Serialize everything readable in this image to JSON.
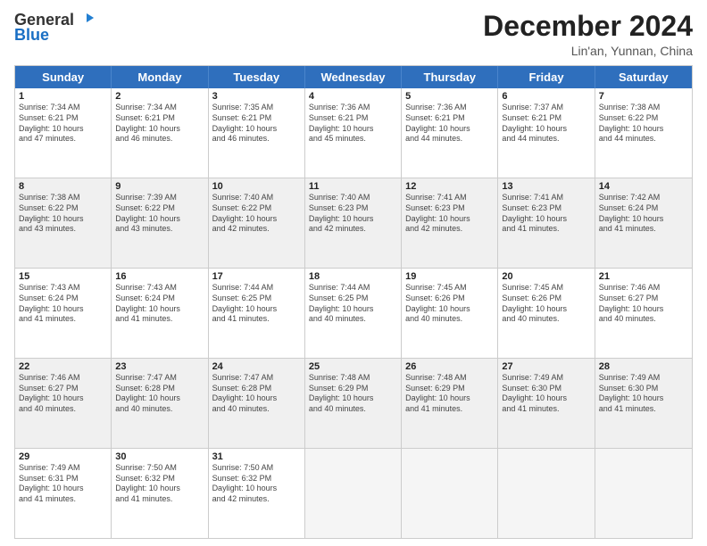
{
  "header": {
    "logo_general": "General",
    "logo_blue": "Blue",
    "title": "December 2024",
    "location": "Lin'an, Yunnan, China"
  },
  "days_of_week": [
    "Sunday",
    "Monday",
    "Tuesday",
    "Wednesday",
    "Thursday",
    "Friday",
    "Saturday"
  ],
  "weeks": [
    [
      {
        "day": "1",
        "info": "Sunrise: 7:34 AM\nSunset: 6:21 PM\nDaylight: 10 hours\nand 47 minutes."
      },
      {
        "day": "2",
        "info": "Sunrise: 7:34 AM\nSunset: 6:21 PM\nDaylight: 10 hours\nand 46 minutes."
      },
      {
        "day": "3",
        "info": "Sunrise: 7:35 AM\nSunset: 6:21 PM\nDaylight: 10 hours\nand 46 minutes."
      },
      {
        "day": "4",
        "info": "Sunrise: 7:36 AM\nSunset: 6:21 PM\nDaylight: 10 hours\nand 45 minutes."
      },
      {
        "day": "5",
        "info": "Sunrise: 7:36 AM\nSunset: 6:21 PM\nDaylight: 10 hours\nand 44 minutes."
      },
      {
        "day": "6",
        "info": "Sunrise: 7:37 AM\nSunset: 6:21 PM\nDaylight: 10 hours\nand 44 minutes."
      },
      {
        "day": "7",
        "info": "Sunrise: 7:38 AM\nSunset: 6:22 PM\nDaylight: 10 hours\nand 44 minutes."
      }
    ],
    [
      {
        "day": "8",
        "info": "Sunrise: 7:38 AM\nSunset: 6:22 PM\nDaylight: 10 hours\nand 43 minutes."
      },
      {
        "day": "9",
        "info": "Sunrise: 7:39 AM\nSunset: 6:22 PM\nDaylight: 10 hours\nand 43 minutes."
      },
      {
        "day": "10",
        "info": "Sunrise: 7:40 AM\nSunset: 6:22 PM\nDaylight: 10 hours\nand 42 minutes."
      },
      {
        "day": "11",
        "info": "Sunrise: 7:40 AM\nSunset: 6:23 PM\nDaylight: 10 hours\nand 42 minutes."
      },
      {
        "day": "12",
        "info": "Sunrise: 7:41 AM\nSunset: 6:23 PM\nDaylight: 10 hours\nand 42 minutes."
      },
      {
        "day": "13",
        "info": "Sunrise: 7:41 AM\nSunset: 6:23 PM\nDaylight: 10 hours\nand 41 minutes."
      },
      {
        "day": "14",
        "info": "Sunrise: 7:42 AM\nSunset: 6:24 PM\nDaylight: 10 hours\nand 41 minutes."
      }
    ],
    [
      {
        "day": "15",
        "info": "Sunrise: 7:43 AM\nSunset: 6:24 PM\nDaylight: 10 hours\nand 41 minutes."
      },
      {
        "day": "16",
        "info": "Sunrise: 7:43 AM\nSunset: 6:24 PM\nDaylight: 10 hours\nand 41 minutes."
      },
      {
        "day": "17",
        "info": "Sunrise: 7:44 AM\nSunset: 6:25 PM\nDaylight: 10 hours\nand 41 minutes."
      },
      {
        "day": "18",
        "info": "Sunrise: 7:44 AM\nSunset: 6:25 PM\nDaylight: 10 hours\nand 40 minutes."
      },
      {
        "day": "19",
        "info": "Sunrise: 7:45 AM\nSunset: 6:26 PM\nDaylight: 10 hours\nand 40 minutes."
      },
      {
        "day": "20",
        "info": "Sunrise: 7:45 AM\nSunset: 6:26 PM\nDaylight: 10 hours\nand 40 minutes."
      },
      {
        "day": "21",
        "info": "Sunrise: 7:46 AM\nSunset: 6:27 PM\nDaylight: 10 hours\nand 40 minutes."
      }
    ],
    [
      {
        "day": "22",
        "info": "Sunrise: 7:46 AM\nSunset: 6:27 PM\nDaylight: 10 hours\nand 40 minutes."
      },
      {
        "day": "23",
        "info": "Sunrise: 7:47 AM\nSunset: 6:28 PM\nDaylight: 10 hours\nand 40 minutes."
      },
      {
        "day": "24",
        "info": "Sunrise: 7:47 AM\nSunset: 6:28 PM\nDaylight: 10 hours\nand 40 minutes."
      },
      {
        "day": "25",
        "info": "Sunrise: 7:48 AM\nSunset: 6:29 PM\nDaylight: 10 hours\nand 40 minutes."
      },
      {
        "day": "26",
        "info": "Sunrise: 7:48 AM\nSunset: 6:29 PM\nDaylight: 10 hours\nand 41 minutes."
      },
      {
        "day": "27",
        "info": "Sunrise: 7:49 AM\nSunset: 6:30 PM\nDaylight: 10 hours\nand 41 minutes."
      },
      {
        "day": "28",
        "info": "Sunrise: 7:49 AM\nSunset: 6:30 PM\nDaylight: 10 hours\nand 41 minutes."
      }
    ],
    [
      {
        "day": "29",
        "info": "Sunrise: 7:49 AM\nSunset: 6:31 PM\nDaylight: 10 hours\nand 41 minutes."
      },
      {
        "day": "30",
        "info": "Sunrise: 7:50 AM\nSunset: 6:32 PM\nDaylight: 10 hours\nand 41 minutes."
      },
      {
        "day": "31",
        "info": "Sunrise: 7:50 AM\nSunset: 6:32 PM\nDaylight: 10 hours\nand 42 minutes."
      },
      {
        "day": "",
        "info": ""
      },
      {
        "day": "",
        "info": ""
      },
      {
        "day": "",
        "info": ""
      },
      {
        "day": "",
        "info": ""
      }
    ]
  ]
}
